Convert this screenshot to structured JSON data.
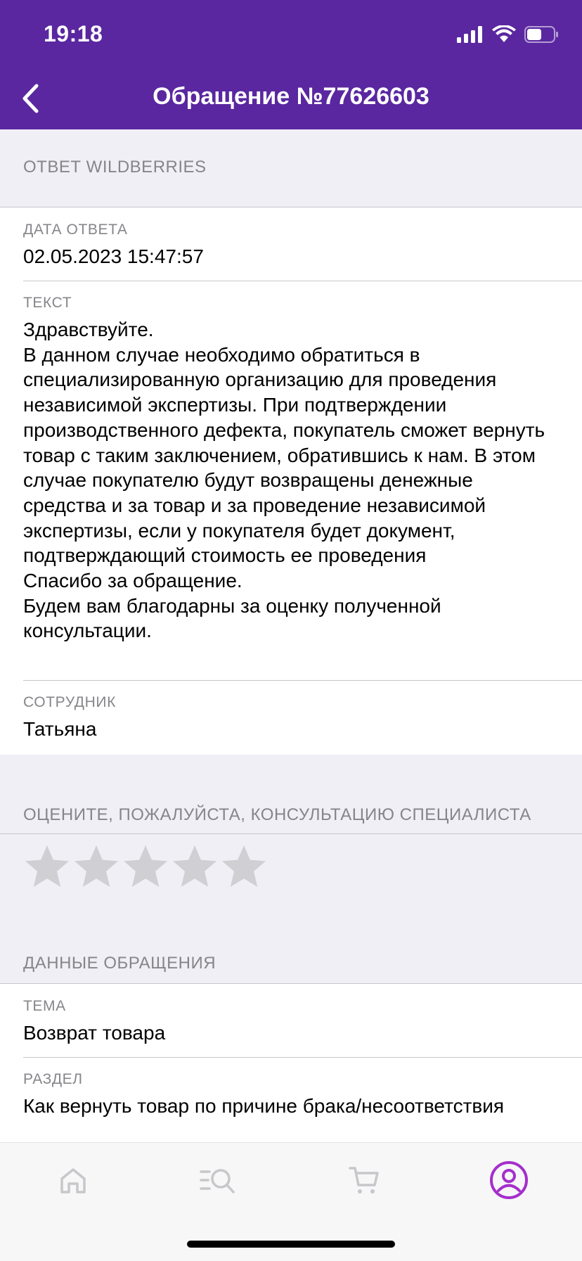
{
  "status_bar": {
    "time": "19:18"
  },
  "header": {
    "title": "Обращение №77626603",
    "back_icon": "chevron-left-icon"
  },
  "answer_section": {
    "title": "ОТВЕТ WILDBERRIES",
    "date_label": "ДАТА ОТВЕТА",
    "date_value": "02.05.2023 15:47:57",
    "text_label": "ТЕКСТ",
    "text_value": "Здравствуйте.\nВ данном случае необходимо обратиться в специализированную организацию для проведения независимой экспертизы. При подтверждении производственного дефекта, покупатель сможет вернуть товар с таким заключением, обратившись к нам. В этом случае покупателю будут возвращены денежные средства и за товар и за проведение независимой экспертизы, если у покупателя будет документ, подтверждающий стоимость ее проведения\nСпасибо за обращение.\nБудем вам благодарны за оценку полученной консультации.",
    "employee_label": "СОТРУДНИК",
    "employee_value": "Татьяна"
  },
  "rating_section": {
    "title": "ОЦЕНИТЕ, ПОЖАЛУЙСТА, КОНСУЛЬТАЦИЮ СПЕЦИАЛИСТА",
    "stars_total": 5,
    "stars_selected": 0,
    "star_color": "#cfcfd4"
  },
  "request_section": {
    "title": "ДАННЫЕ ОБРАЩЕНИЯ",
    "topic_label": "ТЕМА",
    "topic_value": "Возврат товара",
    "section_label": "РАЗДЕЛ",
    "section_value": "Как вернуть товар по причине брака/несоответствия"
  },
  "tabbar": {
    "items": [
      {
        "name": "home",
        "icon": "home-icon"
      },
      {
        "name": "catalog",
        "icon": "catalog-search-icon"
      },
      {
        "name": "cart",
        "icon": "cart-icon"
      },
      {
        "name": "profile",
        "icon": "profile-icon",
        "active": true
      }
    ],
    "active_color": "#a52ecc"
  },
  "colors": {
    "header_bg": "#5a27a0",
    "page_bg": "#f0eff5",
    "secondary_text": "#86858a"
  }
}
